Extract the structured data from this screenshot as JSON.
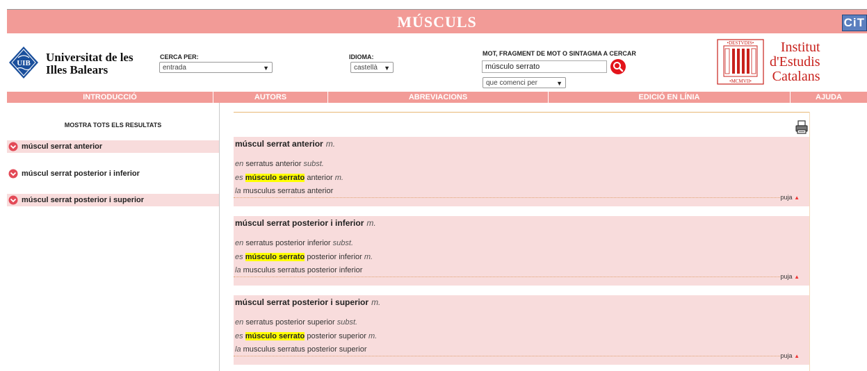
{
  "header": {
    "title": "MÚSCULS",
    "cit_badge": "CiT"
  },
  "uib": {
    "name_line1": "Universitat de les",
    "name_line2": "Illes Balears"
  },
  "search": {
    "cerca_label": "CERCA PER:",
    "cerca_value": "entrada",
    "idioma_label": "IDIOMA:",
    "idioma_value": "castellà",
    "query_label": "MOT, FRAGMENT DE MOT O SINTAGMA A CERCAR",
    "query_value": "músculo serrato",
    "match_value": "que comenci per"
  },
  "iec": {
    "line1": "Institut",
    "line2": "d'Estudis",
    "line3": "Catalans"
  },
  "nav": [
    {
      "label": "INTRODUCCIÓ"
    },
    {
      "label": "AUTORS"
    },
    {
      "label": "ABREVIACIONS"
    },
    {
      "label": "EDICIÓ EN LÍNIA"
    },
    {
      "label": "AJUDA"
    }
  ],
  "sidebar": {
    "show_all": "MOSTRA TOTS ELS RESULTATS",
    "items": [
      {
        "label": "múscul serrat anterior"
      },
      {
        "label": "múscul serrat posterior i inferior"
      },
      {
        "label": "múscul serrat posterior i superior"
      }
    ]
  },
  "entries": [
    {
      "term": "múscul serrat anterior",
      "gram": "m.",
      "en_code": "en",
      "en_text": "serratus anterior",
      "en_gram": "subst.",
      "es_code": "es",
      "es_mark": "músculo serrato",
      "es_rest": "anterior",
      "es_gram": "m.",
      "la_code": "la",
      "la_text": "musculus serratus anterior",
      "up": "puja"
    },
    {
      "term": "múscul serrat posterior i inferior",
      "gram": "m.",
      "en_code": "en",
      "en_text": "serratus posterior inferior",
      "en_gram": "subst.",
      "es_code": "es",
      "es_mark": "músculo serrato",
      "es_rest": "posterior inferior",
      "es_gram": "m.",
      "la_code": "la",
      "la_text": "musculus serratus posterior inferior",
      "up": "puja"
    },
    {
      "term": "múscul serrat posterior i superior",
      "gram": "m.",
      "en_code": "en",
      "en_text": "serratus posterior superior",
      "en_gram": "subst.",
      "es_code": "es",
      "es_mark": "músculo serrato",
      "es_rest": "posterior superior",
      "es_gram": "m.",
      "la_code": "la",
      "la_text": "musculus serratus posterior superior",
      "up": "puja"
    }
  ],
  "icons": {
    "search": "magnifier-icon",
    "print": "printer-icon",
    "bullet": "red-arrow-bullet-icon"
  },
  "colors": {
    "header_bg": "#f29b97",
    "entry_bg": "#f8dcdc",
    "highlight": "#ffff00",
    "iec_red": "#c8211c",
    "cit_blue": "#5b7fbf"
  }
}
